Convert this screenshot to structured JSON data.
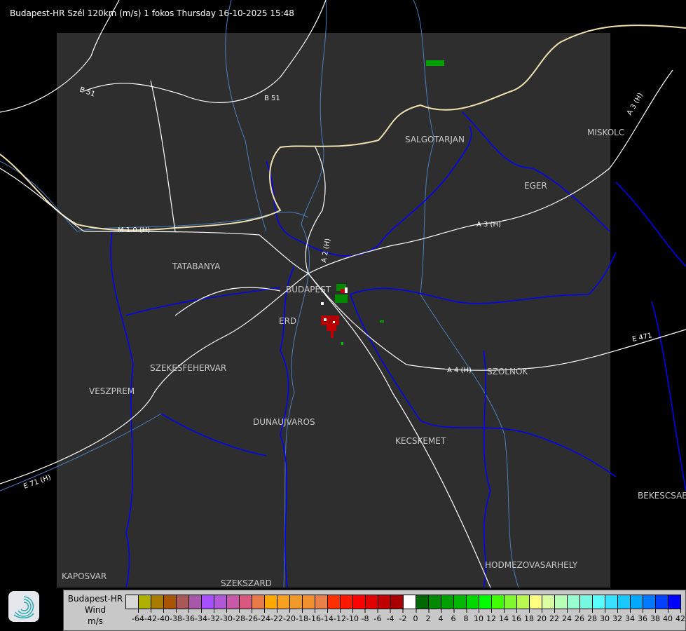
{
  "title": "Budapest-HR Szél 120km (m/s) 1 fokos Thursday 16-10-2025 15:48",
  "cities": [
    {
      "name": "SALGOTARJAN"
    },
    {
      "name": "MISKOLC"
    },
    {
      "name": "EGER"
    },
    {
      "name": "TATABANYA"
    },
    {
      "name": "BUDAPEST"
    },
    {
      "name": "ERD"
    },
    {
      "name": "SZEKESFEHERVAR"
    },
    {
      "name": "VESZPREM"
    },
    {
      "name": "DUNAUJVAROS"
    },
    {
      "name": "KECSKEMET"
    },
    {
      "name": "SZOLNOK"
    },
    {
      "name": "BEKESCSABA"
    },
    {
      "name": "HODMEZOVASARHELY"
    },
    {
      "name": "KAPOSVAR"
    },
    {
      "name": "SZEKSZARD"
    }
  ],
  "roads": [
    "B 51",
    "B 51",
    "A 3 (H)",
    "A 4 (H)",
    "M 1 0 (H)",
    "A 2 (H)",
    "E 71 (H)",
    "E 471",
    "A 3 (H)"
  ],
  "colors": {
    "background": "#000000",
    "radar_area": "#2e2e2e",
    "roads": "#ffffff",
    "borders": "#0000ff",
    "rivers": "#4a7fc0",
    "country_border": "#f0e0b0"
  },
  "legend": {
    "title_line1": "Budapest-HR",
    "title_line2": "Wind",
    "title_line3": "m/s",
    "swatch_colors": [
      "#d8d8d8",
      "#b0b000",
      "#a87c00",
      "#a85400",
      "#a85858",
      "#a858a8",
      "#a850ff",
      "#b058d8",
      "#c858a8",
      "#d85880",
      "#e87c48",
      "#ffa800",
      "#f8a020",
      "#f09828",
      "#f09030",
      "#e88048",
      "#ff3000",
      "#ff1800",
      "#ff0000",
      "#e00000",
      "#c00000",
      "#a80000",
      "#ffffff",
      "#006800",
      "#008800",
      "#00a000",
      "#00b800",
      "#00d800",
      "#00ff00",
      "#40ff00",
      "#80f830",
      "#b8f850",
      "#ffff80",
      "#d8ffa0",
      "#b8ffb8",
      "#98ffd0",
      "#78f8e0",
      "#58ffff",
      "#38e0ff",
      "#18c8ff",
      "#00a8ff",
      "#0078ff",
      "#0040ff",
      "#0000ff"
    ],
    "tick_labels": [
      "-64",
      "-42",
      "-40",
      "-38",
      "-36",
      "-34",
      "-32",
      "-30",
      "-28",
      "-26",
      "-24",
      "-22",
      "-20",
      "-18",
      "-16",
      "-14",
      "-12",
      "-10",
      "-8",
      "-6",
      "-4",
      "-2",
      "0",
      "2",
      "4",
      "6",
      "8",
      "10",
      "12",
      "14",
      "16",
      "18",
      "20",
      "22",
      "24",
      "26",
      "28",
      "30",
      "32",
      "34",
      "36",
      "38",
      "40",
      "42"
    ]
  }
}
